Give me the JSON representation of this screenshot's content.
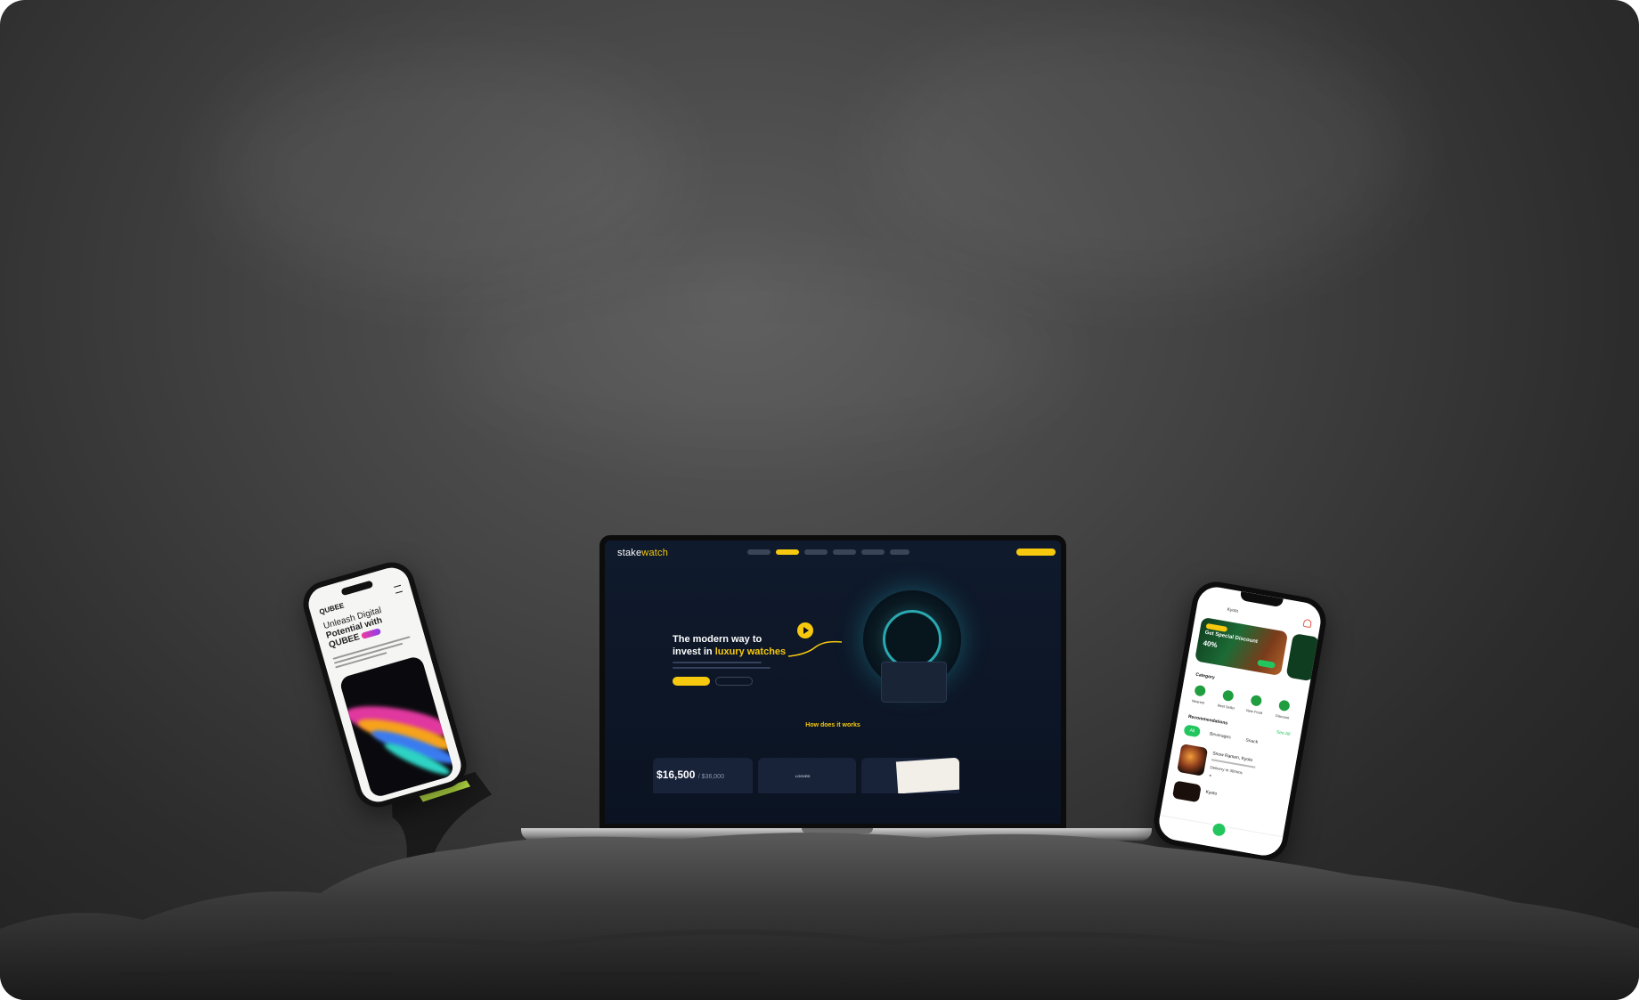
{
  "laptop": {
    "logo_prefix": "stake",
    "logo_suffix": "watch",
    "hero_title_line1": "The modern way to",
    "hero_title_line2_prefix": "invest in ",
    "hero_title_line2_accent": "luxury watches",
    "how_prefix": "How does ",
    "how_accent": "it works",
    "price": "$16,500",
    "price_total": "/ $36,000",
    "locked_label": "LOCKED"
  },
  "phone_left": {
    "brand": "QUBEE",
    "title_line1": "Unleash Digital",
    "title_line2": "Potential with",
    "title_line3": "QUBEE"
  },
  "phone_right": {
    "location": "Kyoto",
    "banner_title": "Get Special Discount",
    "banner_pct": "40%",
    "category_title": "Category",
    "categories": [
      "Nearest",
      "Best Seller",
      "New Food",
      "Discount"
    ],
    "recommendations_title": "Recommendations",
    "see_all": "See All",
    "tabs": [
      "All",
      "Beverages",
      "Snack"
    ],
    "item1_name": "Snow Ramen, Kyoto",
    "item1_delivery": "Delivery in 30mins",
    "item2_name": "Kyoto"
  },
  "colors": {
    "accent_yellow": "#f6c90e",
    "accent_green": "#22c55e",
    "laptop_bg": "#0f1a2c"
  }
}
